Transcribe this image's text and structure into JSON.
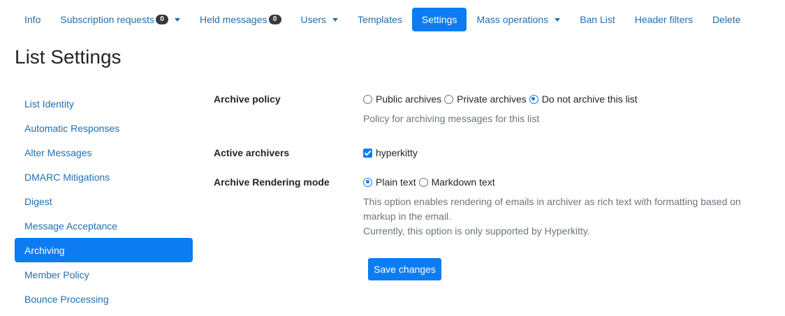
{
  "nav": {
    "items": [
      {
        "label": "Info"
      },
      {
        "label": "Subscription requests",
        "badge": "0"
      },
      {
        "label": "Held messages",
        "badge": "0"
      },
      {
        "label": "Users"
      },
      {
        "label": "Templates"
      },
      {
        "label": "Settings"
      },
      {
        "label": "Mass operations"
      },
      {
        "label": "Ban List"
      },
      {
        "label": "Header filters"
      },
      {
        "label": "Delete"
      }
    ],
    "active": "Settings"
  },
  "page_title": "List Settings",
  "sidebar": {
    "items": [
      {
        "label": "List Identity"
      },
      {
        "label": "Automatic Responses"
      },
      {
        "label": "Alter Messages"
      },
      {
        "label": "DMARC Mitigations"
      },
      {
        "label": "Digest"
      },
      {
        "label": "Message Acceptance"
      },
      {
        "label": "Archiving"
      },
      {
        "label": "Member Policy"
      },
      {
        "label": "Bounce Processing"
      }
    ],
    "active": "Archiving"
  },
  "form": {
    "archive_policy": {
      "label": "Archive policy",
      "options": [
        "Public archives",
        "Private archives",
        "Do not archive this list"
      ],
      "selected": "Do not archive this list",
      "help": "Policy for archiving messages for this list"
    },
    "active_archivers": {
      "label": "Active archivers",
      "option": "hyperkitty",
      "checked": true
    },
    "rendering_mode": {
      "label": "Archive Rendering mode",
      "options": [
        "Plain text",
        "Markdown text"
      ],
      "selected": "Plain text",
      "help_line1": "This option enables rendering of emails in archiver as rich text with formatting based on",
      "help_line2": "markup in the email.",
      "help_line3": "Currently, this option is only supported by Hyperkitty."
    },
    "save_label": "Save changes"
  },
  "colors": {
    "accent": "#0d7cf2",
    "link": "#1f6fb2",
    "muted": "#6c757d",
    "badge": "#343a40"
  }
}
